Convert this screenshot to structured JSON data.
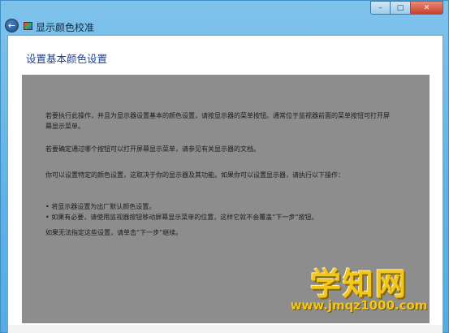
{
  "window": {
    "title": "显示颜色校准",
    "back_icon": "←",
    "controls": {
      "minimize": "–",
      "maximize": "□",
      "close": "✕"
    }
  },
  "page": {
    "title": "设置基本颜色设置",
    "paragraphs": [
      "若要执行此操作，并且为显示器设置基本的颜色设置，请按显示器的菜单按钮。通常位于监视器前面的菜单按钮可打开屏幕显示菜单。",
      "若要确定通过哪个按钮可以打开屏幕显示菜单，请参见有关显示器的文档。",
      "你可以设置特定的颜色设置，这取决于你的显示器及其功能。如果你可以设置显示器，请执行以下操作："
    ],
    "bullets": [
      "• 将显示器设置为出厂默认颜色设置。",
      "• 如果有必要，请使用监视器按钮移动屏幕显示菜单的位置，这样它就不会覆盖“下一步”按钮。"
    ],
    "footer_paragraph": "如果无法指定这些设置，请单击“下一步”继续。"
  },
  "watermark": {
    "main": "学知网",
    "url": "www.jmqz1000.com"
  },
  "colors": {
    "title_blue": "#1e3d8f",
    "panel_gray": "#8d8d8d",
    "chrome_blue": "#5fb2e6",
    "watermark_gold": "#f3c61c"
  }
}
